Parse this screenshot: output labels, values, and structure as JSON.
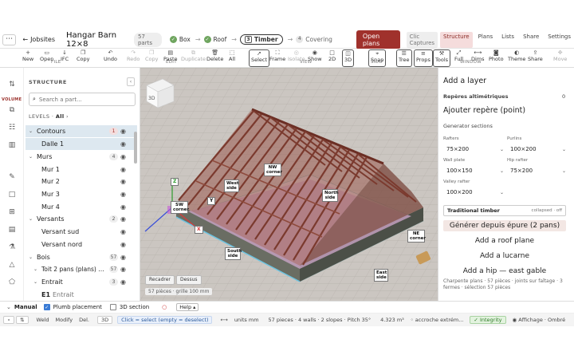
{
  "topbar": {
    "back_label": "Jobsites",
    "project_title": "Hangar Barn 12×8",
    "parts_badge": "57 parts",
    "steps": [
      {
        "label": "Box",
        "state": "done"
      },
      {
        "label": "Roof",
        "state": "done"
      },
      {
        "num": "3",
        "label": "Timber",
        "state": "current"
      },
      {
        "num": "4",
        "label": "Covering",
        "state": "pending"
      }
    ],
    "open_plans": "Open plans",
    "clic_captures": "Clic Captures",
    "tabs": [
      "Structure",
      "Plans",
      "Lists",
      "Share",
      "Settings"
    ]
  },
  "toolbar": {
    "file": [
      "New",
      "Open",
      "IFC",
      "Copy"
    ],
    "edit": [
      "Undo",
      "Redo",
      "Copy",
      "Paste",
      "Duplicate",
      "Delete",
      "All"
    ],
    "view": [
      "Select",
      "Frame",
      "Isolate",
      "Show",
      "2D",
      "3D"
    ],
    "snap": [
      "Snap"
    ],
    "window": [
      "Tree",
      "Props",
      "Tools",
      "Full",
      "Dims",
      "Photo",
      "Theme",
      "Share",
      "Move"
    ],
    "groups": {
      "file": "FILE",
      "edit": "EDIT",
      "view": "VIEW",
      "snap": "SNAP",
      "window": "WINDOW"
    }
  },
  "sidebar": {
    "rail_label": "VOLUME",
    "header": "STRUCTURE",
    "search_placeholder": "Search a part...",
    "levels_label": "LEVELS",
    "levels_value": "All",
    "tree": [
      {
        "label": "Contours",
        "count": "1",
        "type": "group",
        "expanded": true,
        "selected": true
      },
      {
        "label": "Dalle 1",
        "type": "item",
        "selected": true
      },
      {
        "label": "Murs",
        "count": "4",
        "type": "group",
        "expanded": true
      },
      {
        "label": "Mur 1",
        "type": "item"
      },
      {
        "label": "Mur 2",
        "type": "item"
      },
      {
        "label": "Mur 3",
        "type": "item"
      },
      {
        "label": "Mur 4",
        "type": "item"
      },
      {
        "label": "Versants",
        "count": "2",
        "type": "group",
        "expanded": true
      },
      {
        "label": "Versant sud",
        "type": "item"
      },
      {
        "label": "Versant nord",
        "type": "item"
      },
      {
        "label": "Bois",
        "count": "57",
        "type": "group",
        "expanded": true
      },
      {
        "label": "Toit 2 pans (plans) …",
        "count": "57",
        "type": "subgroup",
        "expanded": true
      },
      {
        "label": "Entrait",
        "count": "3",
        "type": "subgroup",
        "expanded": true
      },
      {
        "label": "E1",
        "sublabel": "Entrait",
        "type": "leaf"
      }
    ]
  },
  "viewport": {
    "labels": {
      "nw": "NW corner",
      "west": "West side",
      "north": "North side",
      "sw": "SW corner",
      "ne": "NE corner",
      "south": "South side",
      "east": "East side"
    },
    "axes": {
      "z": "Z",
      "y": "Y",
      "x": "X"
    },
    "cube_label": "3D",
    "buttons": [
      "Recadrer",
      "Dessus"
    ],
    "info": "57 pièces · grille 100 mm"
  },
  "right_panel": {
    "add_layer": "Add a layer",
    "reperes_label": "Repères altimétriques",
    "reperes_count": "0",
    "add_repere": "Ajouter repère (point)",
    "generator_title": "Generator sections",
    "fields": [
      {
        "label": "Rafters",
        "value": "75×200"
      },
      {
        "label": "Purlins",
        "value": "100×200"
      },
      {
        "label": "Wall plate",
        "value": "100×150"
      },
      {
        "label": "Hip rafter",
        "value": "75×200"
      },
      {
        "label": "Valley rafter",
        "value": "100×200"
      }
    ],
    "traditional_label": "Traditional timber",
    "traditional_state": "collapsed · off",
    "actions": [
      "Générer depuis épure (2 pans)",
      "Add a roof plane",
      "Add a lucarne",
      "Add a hip — east gable"
    ],
    "footer": "Charpente plans · 57 pièces · joints sur faîtage · 3 fermes · sélection 57 pièces"
  },
  "bottom1": {
    "mode": "Manual",
    "plumb": "Plumb placement",
    "section": "3D section",
    "help": "Help"
  },
  "bottom2": {
    "tools": [
      "Weld",
      "Modify",
      "Del."
    ],
    "mode_3d": "3D",
    "hint": "Click = select (empty = deselect)",
    "units": "units mm",
    "stats": "57 pieces · 4 walls · 2 slopes · Pitch 35°",
    "area": "4.323  m³",
    "accroche": "accroche extrém...",
    "integrity": "Integrity",
    "affichage": "Affichage · Ombré"
  }
}
